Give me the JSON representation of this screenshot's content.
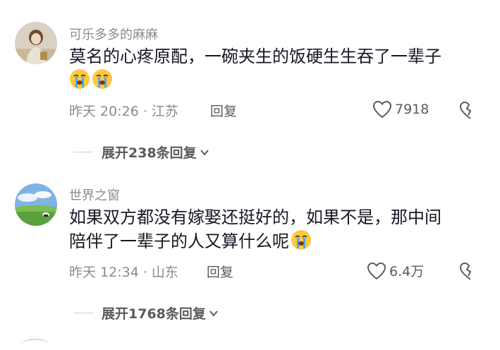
{
  "comments": [
    {
      "username": "可乐多多的麻麻",
      "lines": [
        "莫名的心疼原配，一碗夹生的饭硬生生吞了一辈子",
        ""
      ],
      "emojis": [
        "crying-face-emoji",
        "crying-face-emoji"
      ],
      "time": "昨天 20:26 · 江苏",
      "reply_label": "回复",
      "likes": "7918",
      "expand_label": "展开238条回复"
    },
    {
      "username": "世界之窗",
      "lines": [
        "如果双方都没有嫁娶还挺好的，如果不是，那中间",
        "陪伴了一辈子的人又算什么呢"
      ],
      "emojis": [
        "crying-face-emoji"
      ],
      "time": "昨天 12:34 · 山东",
      "reply_label": "回复",
      "likes": "6.4万",
      "expand_label": "展开1768条回复"
    }
  ],
  "colors": {
    "text": "#161823",
    "muted": "#8a8b91",
    "action": "#5a5b60",
    "emoji_face": "#ffc83d",
    "emoji_tear": "#4aa8ff"
  }
}
